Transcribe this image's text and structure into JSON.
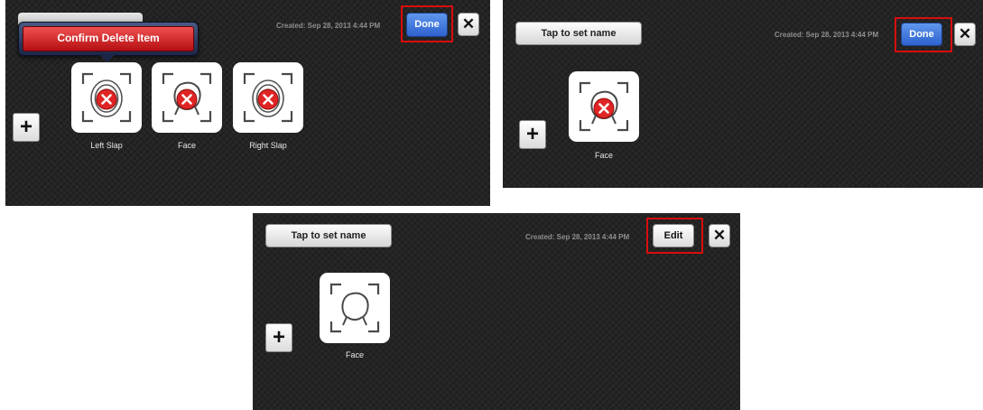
{
  "panel1": {
    "created": "Created: Sep 28, 2013 4:44 PM",
    "done_label": "Done",
    "close_label": "✕",
    "add_label": "+",
    "confirm_label": "Confirm Delete Item",
    "items": [
      {
        "label": "Left Slap",
        "icon": "left-slap-icon"
      },
      {
        "label": "Face",
        "icon": "face-icon"
      },
      {
        "label": "Right Slap",
        "icon": "right-slap-icon"
      }
    ]
  },
  "panel2": {
    "name_label": "Tap to set name",
    "created": "Created: Sep 28, 2013 4:44 PM",
    "done_label": "Done",
    "close_label": "✕",
    "add_label": "+",
    "items": [
      {
        "label": "Face",
        "icon": "face-icon"
      }
    ]
  },
  "panel3": {
    "name_label": "Tap to set name",
    "created": "Created: Sep 28, 2013 4:44 PM",
    "edit_label": "Edit",
    "close_label": "✕",
    "add_label": "+",
    "items": [
      {
        "label": "Face",
        "icon": "face-icon"
      }
    ]
  },
  "colors": {
    "highlight": "#d90d0d",
    "done_blue": "#2d62cd",
    "delete_red": "#e02424",
    "background": "#242424"
  }
}
